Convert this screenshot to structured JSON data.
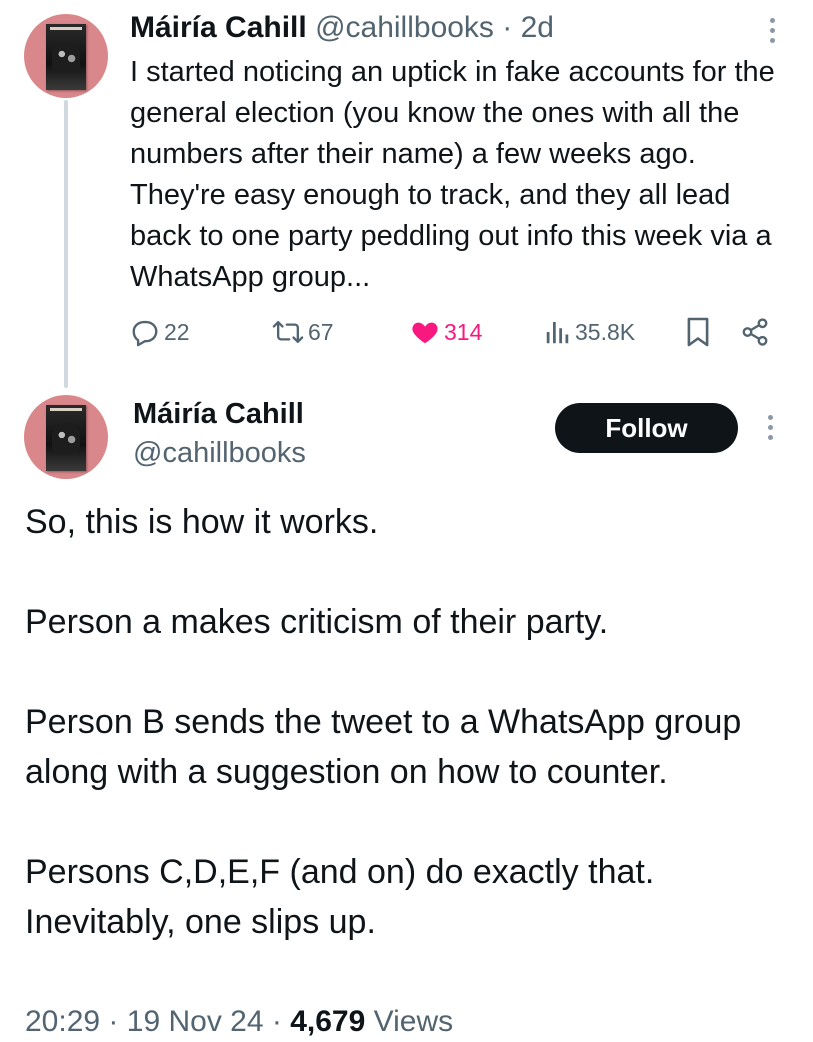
{
  "parent_tweet": {
    "author_name": "Máiría Cahill",
    "handle": "@cahillbooks",
    "separator": "·",
    "time_ago": "2d",
    "text": "I started noticing an uptick in fake accounts for the general election (you know the ones with all the numbers after their name) a few weeks ago. They're easy enough to track, and they all lead back to one party peddling out info this week via a WhatsApp group...",
    "actions": {
      "replies": "22",
      "reposts": "67",
      "likes": "314",
      "views": "35.8K"
    },
    "icons": [
      "reply-icon",
      "repost-icon",
      "like-icon",
      "views-icon",
      "bookmark-icon",
      "share-icon",
      "more-icon"
    ],
    "like_color": "#f91880"
  },
  "main_tweet": {
    "author_name": "Máiría Cahill",
    "handle": "@cahillbooks",
    "follow_label": "Follow",
    "paragraphs": [
      "So, this is how it works.",
      "Person a makes criticism of their party.",
      "Person B sends the tweet to a WhatsApp group along with a suggestion on how to counter.",
      "Persons C,D,E,F (and on) do exactly that. Inevitably, one slips up."
    ],
    "meta": {
      "time": "20:29",
      "separator": "·",
      "date": "19 Nov 24",
      "views_count": "4,679",
      "views_label": "Views"
    }
  },
  "colors": {
    "text": "#0f1419",
    "muted": "#536471",
    "thread_line": "#cfd9de",
    "follow_bg": "#0f1419",
    "avatar_bg": "#d9878a"
  }
}
